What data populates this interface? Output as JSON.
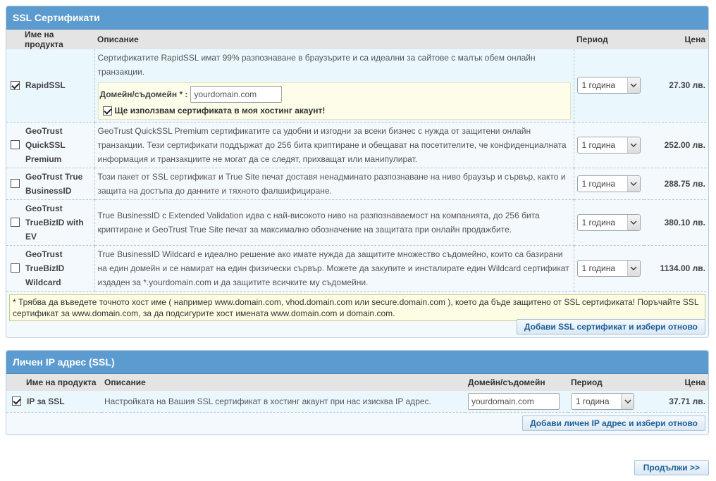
{
  "ssl": {
    "title": "SSL Сертификати",
    "headers": {
      "name": "Име на продукта",
      "desc": "Описание",
      "period": "Период",
      "price": "Цена"
    },
    "products": [
      {
        "name": "RapidSSL",
        "desc": "Сертификатите RapidSSL имат 99% разпознаване в браузърите и са идеални за сайтове с малък обем онлайн транзакции.",
        "period": "1 година",
        "price": "27.30 лв.",
        "checked": true
      },
      {
        "name": "GeoTrust QuickSSL Premium",
        "desc": "GeoTrust QuickSSL Premium сертификатите са удобни и изгодни за всеки бизнес с нужда от защитени онлайн транзакции. Тези сертификати поддържат до 256 бита криптиране и обещават на посетителите, че конфиденциалната информация и транзакциите не могат да се следят, прихващат или манипулират.",
        "period": "1 година",
        "price": "252.00 лв.",
        "checked": false
      },
      {
        "name": "GeoTrust True BusinessID",
        "desc": "Този пакет от SSL сертификат и True Site печат доставя ненадминато разпознаване на ниво браузър и сървър, както и защита на достъпа до данните и тяхното фалшифициране.",
        "period": "1 година",
        "price": "288.75 лв.",
        "checked": false
      },
      {
        "name": "GeoTrust TrueBizID with EV",
        "desc": "True BusinessID с Extended Validation идва с най-високото ниво на разпознаваемост на компанията, до 256 бита криптиране и GeoTrust True Site печат за максимално обозначение на защитата при онлайн продажбите.",
        "period": "1 година",
        "price": "380.10 лв.",
        "checked": false
      },
      {
        "name": "GeoTrust TrueBizID Wildcard",
        "desc": "True BusinessID Wildcard е идеално решение ако имате нужда да защитите множество съдомейно, които са базирани на един домейн и се намират на един физически сървър. Можете да закупите и инсталирате един Wildcard сертификат издаден за *.yourdomain.com и да защитите всичките му съдомейни.",
        "period": "1 година",
        "price": "1134.00 лв.",
        "checked": false
      }
    ],
    "domain_label": "Домейн/съдомейн * :",
    "domain_value": "yourdomain.com",
    "hosting_label": "Ще използвам сертификата в моя хостинг акаунт!",
    "note": "* Трябва да въведете точното хост име ( например www.domain.com, vhod.domain.com или secure.domain.com ), което да бъде защитено от SSL сертификата! Поръчайте SSL сертификат за www.domain.com, за да подсигурите хост имената www.domain.com и domain.com.",
    "add_button": "Добави SSL сертификат и избери отново"
  },
  "ip": {
    "title": "Личен IP адрес (SSL)",
    "headers": {
      "name": "Име на продукта",
      "desc": "Описание",
      "domain": "Домейн/съдомейн",
      "period": "Период",
      "price": "Цена"
    },
    "product": {
      "name": "IP за SSL",
      "desc": "Настройката на Вашия SSL сертификат в хостинг акаунт при нас изисква IP адрес.",
      "domain_value": "yourdomain.com",
      "period": "1 година",
      "price": "37.71 лв.",
      "checked": true
    },
    "add_button": "Добави личен IP адрес и избери отново"
  },
  "continue_button": "Продължи >>",
  "icons": {
    "checkbox": "checkbox-icon",
    "dropdown": "chevron-down-icon"
  },
  "colors": {
    "header": "#5b9bcf",
    "selected_row": "#eaf8fe",
    "note_bg": "#fdfde4",
    "button_text": "#1f5f99"
  }
}
